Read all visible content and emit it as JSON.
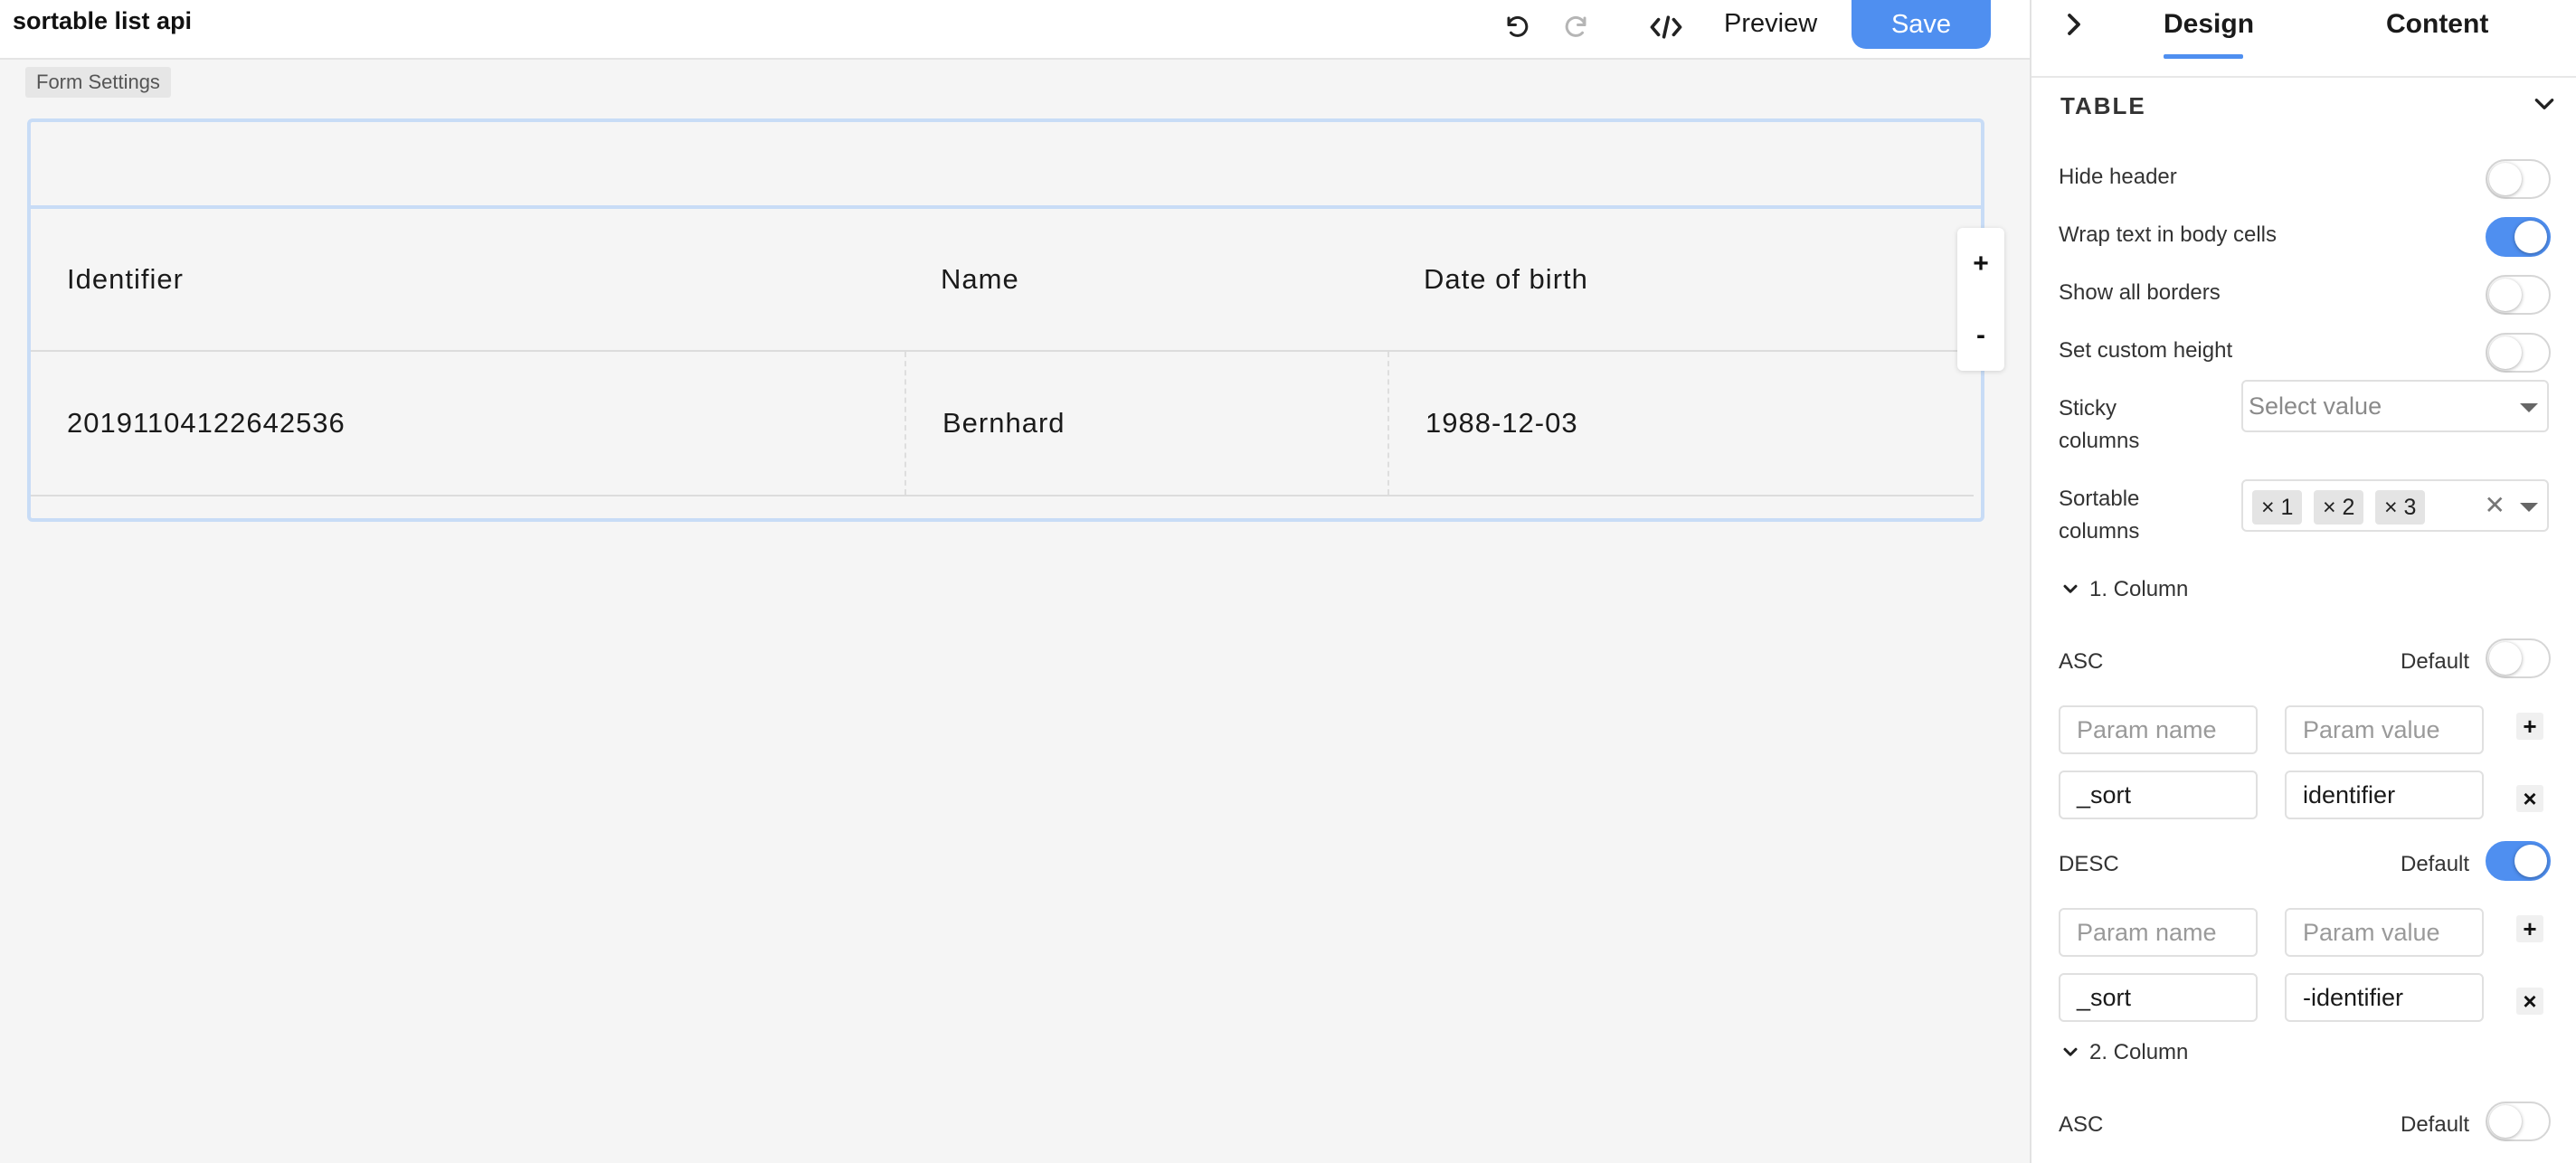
{
  "app": {
    "title": "sortable list api"
  },
  "toolbar": {
    "undo_icon": "undo-icon",
    "redo_icon": "redo-icon",
    "code_icon": "code-icon",
    "preview_label": "Preview",
    "save_label": "Save"
  },
  "canvas": {
    "form_settings_label": "Form Settings",
    "table": {
      "headers": [
        "Identifier",
        "Name",
        "Date of birth"
      ],
      "rows": [
        [
          "20191104122642536",
          "Bernhard",
          "1988-12-03"
        ]
      ]
    },
    "zoom": {
      "in_label": "+",
      "out_label": "-"
    }
  },
  "panel": {
    "collapse_icon": "chevron-right-icon",
    "tabs": [
      "Design",
      "Content"
    ],
    "active_tab": "Design",
    "section_title": "TABLE",
    "settings": {
      "hide_header": {
        "label": "Hide header",
        "on": false
      },
      "wrap_text": {
        "label": "Wrap text in body cells",
        "on": true
      },
      "show_borders": {
        "label": "Show all borders",
        "on": false
      },
      "custom_height": {
        "label": "Set custom height",
        "on": false
      }
    },
    "sticky_columns": {
      "label_1": "Sticky",
      "label_2": "columns",
      "placeholder": "Select value"
    },
    "sortable_columns": {
      "label_1": "Sortable",
      "label_2": "columns",
      "chips": [
        "× 1",
        "× 2",
        "× 3"
      ],
      "clear": "✕"
    },
    "columns": [
      {
        "title": "1. Column",
        "asc": {
          "label": "ASC",
          "default_label": "Default",
          "default_on": false,
          "param_name_placeholder": "Param name",
          "param_value_placeholder": "Param value",
          "param_name": "_sort",
          "param_value": "identifier"
        },
        "desc": {
          "label": "DESC",
          "default_label": "Default",
          "default_on": true,
          "param_name_placeholder": "Param name",
          "param_value_placeholder": "Param value",
          "param_name": "_sort",
          "param_value": "-identifier"
        }
      },
      {
        "title": "2. Column",
        "asc": {
          "label": "ASC",
          "default_label": "Default",
          "default_on": false
        }
      }
    ],
    "add_label": "+",
    "remove_label": "×"
  },
  "colors": {
    "accent": "#4f8ff0",
    "frame": "#c8dcf6",
    "canvas_bg": "#f5f5f5"
  }
}
